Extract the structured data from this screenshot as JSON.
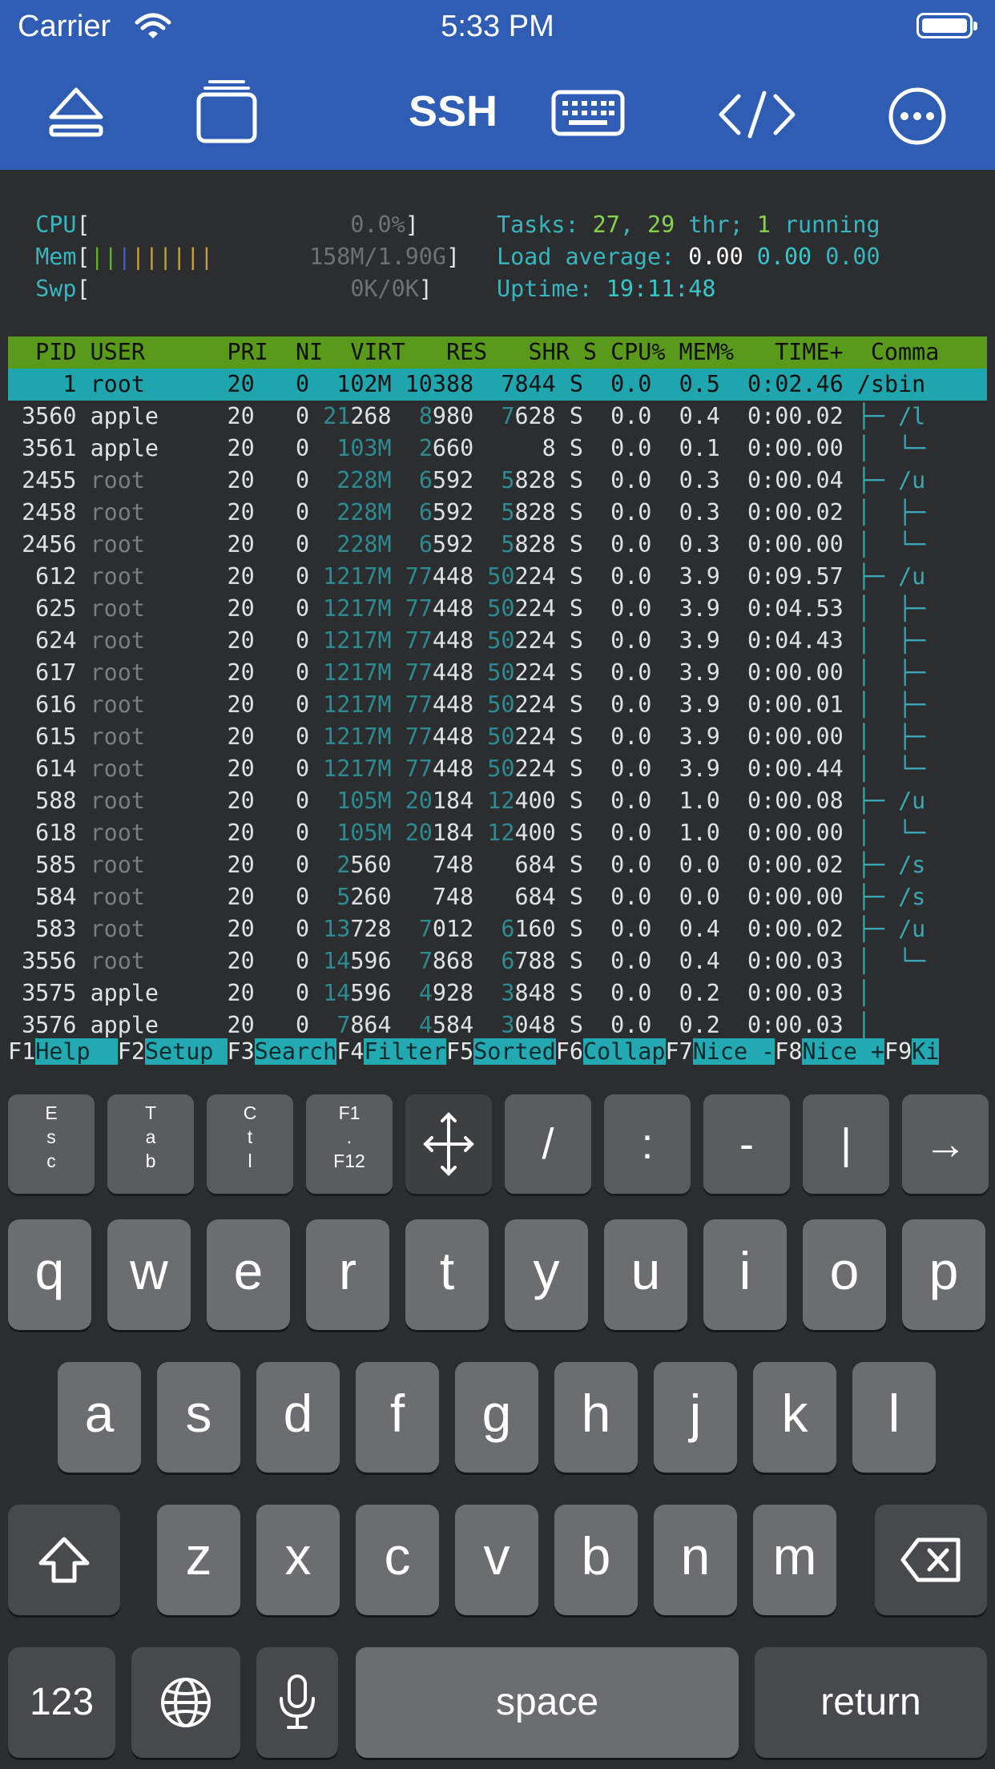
{
  "status_bar": {
    "carrier": "Carrier",
    "time": "5:33 PM"
  },
  "toolbar": {
    "title": "SSH"
  },
  "htop": {
    "meters": {
      "cpu_label": "CPU",
      "cpu_value": "0.0%",
      "mem_label": "Mem",
      "mem_value": "158M/1.90G",
      "swp_label": "Swp",
      "swp_value": "0K/0K"
    },
    "summary": {
      "tasks_label": "Tasks: ",
      "tasks_count": "27",
      "threads": "29",
      "thr_label": " thr; ",
      "running": "1",
      "running_label": " running",
      "load_label": "Load average: ",
      "load1": "0.00",
      "load5": "0.00",
      "load15": "0.00",
      "uptime_label": "Uptime: ",
      "uptime": "19:11:48"
    },
    "header": "  PID USER      PRI  NI  VIRT   RES   SHR S CPU% MEM%   TIME+  Comma",
    "rows": [
      {
        "pid": "1",
        "user": "root",
        "pri": "20",
        "ni": "0",
        "virt": "102M",
        "res": "10388",
        "shr": "7844",
        "s": "S",
        "cpu": "0.0",
        "mem": "0.5",
        "time": "0:02.46",
        "cmd": "/sbin",
        "selected": true
      },
      {
        "pid": "3560",
        "user": "apple",
        "pri": "20",
        "ni": "0",
        "virt": "21268",
        "res": "8980",
        "shr": "7628",
        "s": "S",
        "cpu": "0.0",
        "mem": "0.4",
        "time": "0:00.02",
        "cmd": "├─ /l"
      },
      {
        "pid": "3561",
        "user": "apple",
        "pri": "20",
        "ni": "0",
        "virt": "103M",
        "res": "2660",
        "shr": "8",
        "s": "S",
        "cpu": "0.0",
        "mem": "0.1",
        "time": "0:00.00",
        "cmd": "│  └─"
      },
      {
        "pid": "2455",
        "user": "root",
        "pri": "20",
        "ni": "0",
        "virt": "228M",
        "res": "6592",
        "shr": "5828",
        "s": "S",
        "cpu": "0.0",
        "mem": "0.3",
        "time": "0:00.04",
        "cmd": "├─ /u"
      },
      {
        "pid": "2458",
        "user": "root",
        "pri": "20",
        "ni": "0",
        "virt": "228M",
        "res": "6592",
        "shr": "5828",
        "s": "S",
        "cpu": "0.0",
        "mem": "0.3",
        "time": "0:00.02",
        "cmd": "│  ├─"
      },
      {
        "pid": "2456",
        "user": "root",
        "pri": "20",
        "ni": "0",
        "virt": "228M",
        "res": "6592",
        "shr": "5828",
        "s": "S",
        "cpu": "0.0",
        "mem": "0.3",
        "time": "0:00.00",
        "cmd": "│  └─"
      },
      {
        "pid": "612",
        "user": "root",
        "pri": "20",
        "ni": "0",
        "virt": "1217M",
        "res": "77448",
        "shr": "50224",
        "s": "S",
        "cpu": "0.0",
        "mem": "3.9",
        "time": "0:09.57",
        "cmd": "├─ /u"
      },
      {
        "pid": "625",
        "user": "root",
        "pri": "20",
        "ni": "0",
        "virt": "1217M",
        "res": "77448",
        "shr": "50224",
        "s": "S",
        "cpu": "0.0",
        "mem": "3.9",
        "time": "0:04.53",
        "cmd": "│  ├─"
      },
      {
        "pid": "624",
        "user": "root",
        "pri": "20",
        "ni": "0",
        "virt": "1217M",
        "res": "77448",
        "shr": "50224",
        "s": "S",
        "cpu": "0.0",
        "mem": "3.9",
        "time": "0:04.43",
        "cmd": "│  ├─"
      },
      {
        "pid": "617",
        "user": "root",
        "pri": "20",
        "ni": "0",
        "virt": "1217M",
        "res": "77448",
        "shr": "50224",
        "s": "S",
        "cpu": "0.0",
        "mem": "3.9",
        "time": "0:00.00",
        "cmd": "│  ├─"
      },
      {
        "pid": "616",
        "user": "root",
        "pri": "20",
        "ni": "0",
        "virt": "1217M",
        "res": "77448",
        "shr": "50224",
        "s": "S",
        "cpu": "0.0",
        "mem": "3.9",
        "time": "0:00.01",
        "cmd": "│  ├─"
      },
      {
        "pid": "615",
        "user": "root",
        "pri": "20",
        "ni": "0",
        "virt": "1217M",
        "res": "77448",
        "shr": "50224",
        "s": "S",
        "cpu": "0.0",
        "mem": "3.9",
        "time": "0:00.00",
        "cmd": "│  ├─"
      },
      {
        "pid": "614",
        "user": "root",
        "pri": "20",
        "ni": "0",
        "virt": "1217M",
        "res": "77448",
        "shr": "50224",
        "s": "S",
        "cpu": "0.0",
        "mem": "3.9",
        "time": "0:00.44",
        "cmd": "│  └─"
      },
      {
        "pid": "588",
        "user": "root",
        "pri": "20",
        "ni": "0",
        "virt": "105M",
        "res": "20184",
        "shr": "12400",
        "s": "S",
        "cpu": "0.0",
        "mem": "1.0",
        "time": "0:00.08",
        "cmd": "├─ /u"
      },
      {
        "pid": "618",
        "user": "root",
        "pri": "20",
        "ni": "0",
        "virt": "105M",
        "res": "20184",
        "shr": "12400",
        "s": "S",
        "cpu": "0.0",
        "mem": "1.0",
        "time": "0:00.00",
        "cmd": "│  └─"
      },
      {
        "pid": "585",
        "user": "root",
        "pri": "20",
        "ni": "0",
        "virt": "2560",
        "res": "748",
        "shr": "684",
        "s": "S",
        "cpu": "0.0",
        "mem": "0.0",
        "time": "0:00.02",
        "cmd": "├─ /s"
      },
      {
        "pid": "584",
        "user": "root",
        "pri": "20",
        "ni": "0",
        "virt": "5260",
        "res": "748",
        "shr": "684",
        "s": "S",
        "cpu": "0.0",
        "mem": "0.0",
        "time": "0:00.00",
        "cmd": "├─ /s"
      },
      {
        "pid": "583",
        "user": "root",
        "pri": "20",
        "ni": "0",
        "virt": "13728",
        "res": "7012",
        "shr": "6160",
        "s": "S",
        "cpu": "0.0",
        "mem": "0.4",
        "time": "0:00.02",
        "cmd": "├─ /u"
      },
      {
        "pid": "3556",
        "user": "root",
        "pri": "20",
        "ni": "0",
        "virt": "14596",
        "res": "7868",
        "shr": "6788",
        "s": "S",
        "cpu": "0.0",
        "mem": "0.4",
        "time": "0:00.03",
        "cmd": "│  └─"
      },
      {
        "pid": "3575",
        "user": "apple",
        "pri": "20",
        "ni": "0",
        "virt": "14596",
        "res": "4928",
        "shr": "3848",
        "s": "S",
        "cpu": "0.0",
        "mem": "0.2",
        "time": "0:00.03",
        "cmd": "│"
      },
      {
        "pid": "3576",
        "user": "apple",
        "pri": "20",
        "ni": "0",
        "virt": "7864",
        "res": "4584",
        "shr": "3048",
        "s": "S",
        "cpu": "0.0",
        "mem": "0.2",
        "time": "0:00.03",
        "cmd": "│"
      }
    ],
    "function_keys": [
      {
        "key": "F1",
        "label": "Help  "
      },
      {
        "key": "F2",
        "label": "Setup "
      },
      {
        "key": "F3",
        "label": "Search"
      },
      {
        "key": "F4",
        "label": "Filter"
      },
      {
        "key": "F5",
        "label": "Sorted"
      },
      {
        "key": "F6",
        "label": "Collap"
      },
      {
        "key": "F7",
        "label": "Nice -"
      },
      {
        "key": "F8",
        "label": "Nice +"
      },
      {
        "key": "F9",
        "label": "Ki"
      }
    ]
  },
  "extra_keys": [
    {
      "name": "esc-key",
      "label": "E\ns\nc"
    },
    {
      "name": "tab-key",
      "label": "T\na\nb"
    },
    {
      "name": "ctl-key",
      "label": "C\nt\nl"
    },
    {
      "name": "fn-keys",
      "label": "F1\n.\nF12"
    },
    {
      "name": "arrows-key",
      "label": ""
    },
    {
      "name": "slash-key",
      "label": "/"
    },
    {
      "name": "colon-key",
      "label": ":"
    },
    {
      "name": "dash-key",
      "label": "-"
    },
    {
      "name": "pipe-key",
      "label": "|"
    },
    {
      "name": "arrow-right-key",
      "label": "→"
    }
  ],
  "keyboard": {
    "row1": [
      "q",
      "w",
      "e",
      "r",
      "t",
      "y",
      "u",
      "i",
      "o",
      "p"
    ],
    "row2": [
      "a",
      "s",
      "d",
      "f",
      "g",
      "h",
      "j",
      "k",
      "l"
    ],
    "row3": [
      "z",
      "x",
      "c",
      "v",
      "b",
      "n",
      "m"
    ],
    "numbers_label": "123",
    "space_label": "space",
    "return_label": "return"
  },
  "colors": {
    "toolbar": "#2f5db4",
    "terminal_bg": "#2b2d2f",
    "header_green": "#5a9a1a",
    "selection_teal": "#1ea5ae"
  }
}
